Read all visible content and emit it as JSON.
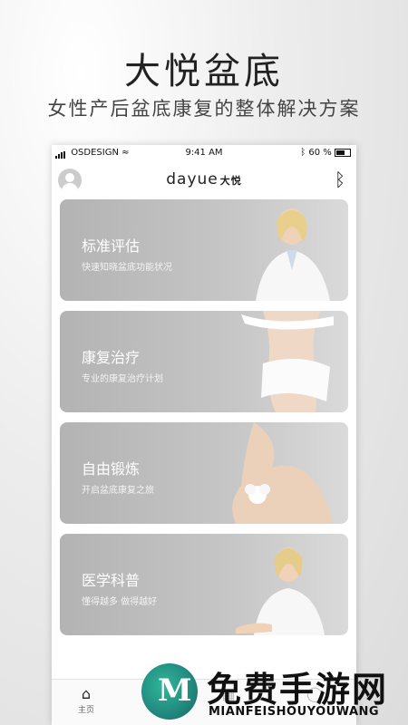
{
  "hero": {
    "title": "大悦盆底",
    "subtitle": "女性产后盆底康复的整体解决方案"
  },
  "status_bar": {
    "carrier": "OSDESIGN",
    "time": "9:41 AM",
    "battery": "60 %"
  },
  "nav": {
    "logo": "dayue",
    "logo_cn": "大悦"
  },
  "cards": [
    {
      "title": "标准评估",
      "subtitle": "快速知晓盆底功能状况"
    },
    {
      "title": "康复治疗",
      "subtitle": "专业的康复治疗计划"
    },
    {
      "title": "自由锻炼",
      "subtitle": "开启盆底康复之旅"
    },
    {
      "title": "医学科普",
      "subtitle": "懂得越多  做得越好"
    }
  ],
  "tabbar": {
    "home_label": "主页"
  },
  "watermark": {
    "cn": "免费手游网",
    "en": "MIANFEISHOUYOUWANG",
    "logo_letter": "M"
  },
  "colors": {
    "card_gray": "#b3b3b3",
    "watermark_green": "#1f7f78"
  }
}
